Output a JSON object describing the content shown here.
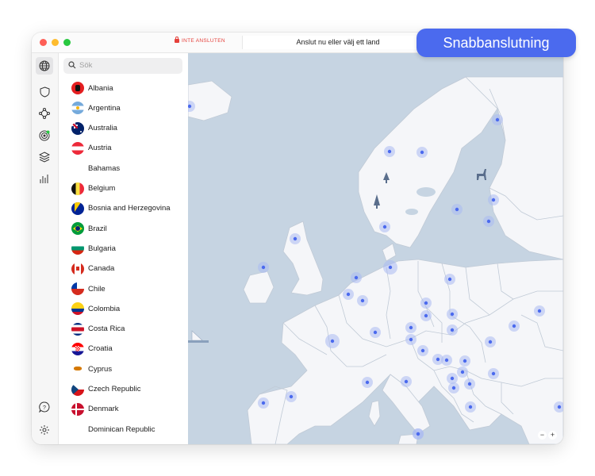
{
  "titlebar": {
    "status": "INTE ANSLUTEN",
    "search_label": "Anslut nu eller välj ett land"
  },
  "quick_connect": {
    "label": "Snabbanslutning",
    "color": "#4b6aee"
  },
  "rail": {
    "icons": [
      "globe-icon",
      "shield-icon",
      "mesh-network-icon",
      "radar-icon",
      "layers-icon",
      "stats-icon"
    ],
    "bottom_icons": [
      "help-icon",
      "settings-icon"
    ]
  },
  "search": {
    "placeholder": "Sök"
  },
  "countries": [
    {
      "name": "Albania",
      "flag": "al"
    },
    {
      "name": "Argentina",
      "flag": "ar"
    },
    {
      "name": "Australia",
      "flag": "au"
    },
    {
      "name": "Austria",
      "flag": "at"
    },
    {
      "name": "Bahamas",
      "flag": ""
    },
    {
      "name": "Belgium",
      "flag": "be"
    },
    {
      "name": "Bosnia and Herzegovina",
      "flag": "ba"
    },
    {
      "name": "Brazil",
      "flag": "br"
    },
    {
      "name": "Bulgaria",
      "flag": "bg"
    },
    {
      "name": "Canada",
      "flag": "ca"
    },
    {
      "name": "Chile",
      "flag": "cl"
    },
    {
      "name": "Colombia",
      "flag": "co"
    },
    {
      "name": "Costa Rica",
      "flag": "cr"
    },
    {
      "name": "Croatia",
      "flag": "hr"
    },
    {
      "name": "Cyprus",
      "flag": "cy"
    },
    {
      "name": "Czech Republic",
      "flag": "cz"
    },
    {
      "name": "Denmark",
      "flag": "dk"
    },
    {
      "name": "Dominican Republic",
      "flag": ""
    }
  ],
  "map": {
    "zoom_out": "−",
    "zoom_in": "+",
    "sea_color": "#c6d4e2",
    "land_color": "#f5f6f9",
    "marker_color": "#4b6aee"
  }
}
